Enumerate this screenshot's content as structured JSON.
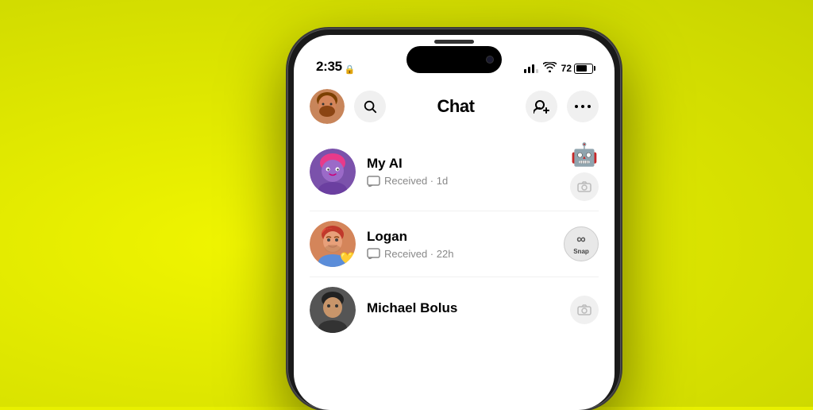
{
  "background": {
    "color": "#d4e600"
  },
  "statusBar": {
    "time": "2:35",
    "batteryPercent": "72",
    "battery_label": "72"
  },
  "header": {
    "title": "Chat",
    "searchLabel": "Search",
    "addFriendLabel": "Add Friend",
    "moreLabel": "More options"
  },
  "chats": [
    {
      "name": "My AI",
      "status": "Received · 1d",
      "rightAction": "robot"
    },
    {
      "name": "Logan",
      "status": "Received · 22h",
      "rightAction": "snap",
      "hasHeart": true
    },
    {
      "name": "Michael Bolus",
      "status": "",
      "rightAction": "camera"
    }
  ]
}
